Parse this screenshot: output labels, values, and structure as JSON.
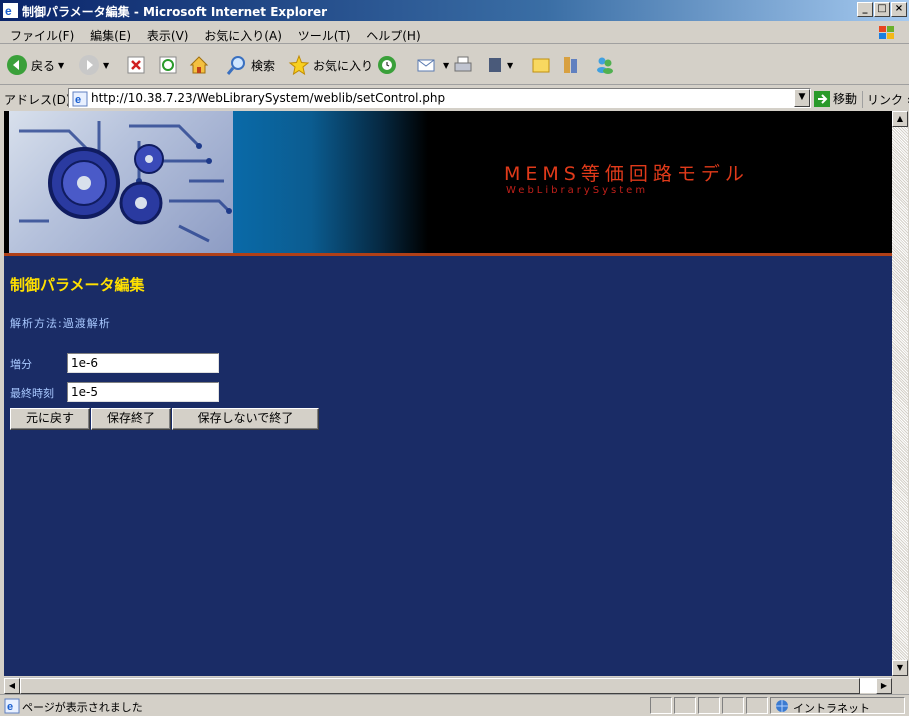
{
  "window": {
    "title": "制御パラメータ編集 - Microsoft Internet Explorer",
    "controls": [
      "_",
      "□",
      "×"
    ]
  },
  "menu": {
    "items": [
      "ファイル(F)",
      "編集(E)",
      "表示(V)",
      "お気に入り(A)",
      "ツール(T)",
      "ヘルプ(H)"
    ]
  },
  "toolbar": {
    "back_label": "戻る",
    "search_label": "検索",
    "favorites_label": "お気に入り"
  },
  "address": {
    "label": "アドレス(D)",
    "url": "http://10.38.7.23/WebLibrarySystem/weblib/setControl.php",
    "go_label": "移動",
    "links_label": "リンク »"
  },
  "banner": {
    "title": "MEMS等価回路モデル",
    "subtitle": "WebLibrarySystem"
  },
  "page": {
    "title": "制御パラメータ編集",
    "method": "解析方法:過渡解析",
    "fields": [
      {
        "label": "増分",
        "value": "1e-6"
      },
      {
        "label": "最終時刻",
        "value": "1e-5"
      }
    ],
    "buttons": {
      "revert": "元に戻す",
      "save_exit": "保存終了",
      "exit_nosave": "保存しないで終了"
    }
  },
  "status": {
    "text": "ページが表示されました",
    "zone": "イントラネット"
  },
  "colors": {
    "page_bg": "#1a2c66",
    "title_yellow": "#ffe000",
    "label_blue": "#a8c8ff",
    "brand_red": "#e03a1a"
  }
}
